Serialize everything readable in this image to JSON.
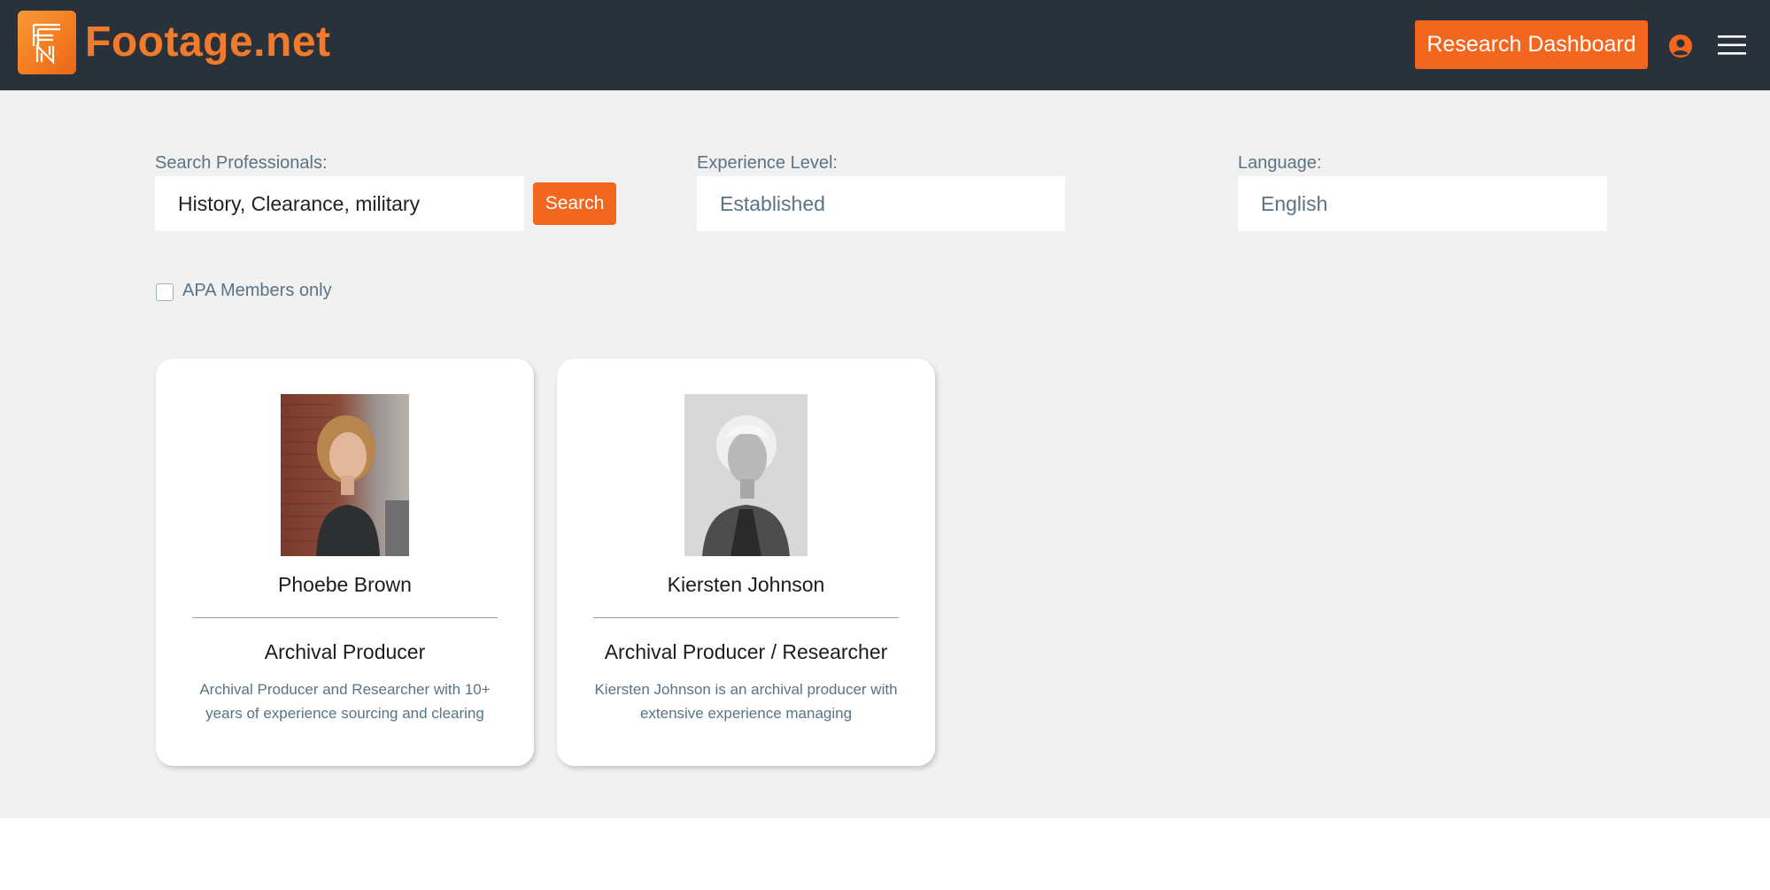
{
  "header": {
    "brand": "Footage.net",
    "dashboard_button": "Research Dashboard",
    "icons": [
      "user-icon",
      "hamburger-menu-icon"
    ],
    "accent_color": "#f2661e",
    "bar_color": "#29323b"
  },
  "filters": {
    "search_label": "Search Professionals:",
    "search_value": "History, Clearance, military",
    "search_button": "Search",
    "experience_label": "Experience Level:",
    "experience_value": "Established",
    "language_label": "Language:",
    "language_value": "English",
    "apa_checkbox_label": "APA Members only",
    "apa_checked": false
  },
  "results": [
    {
      "name": "Phoebe Brown",
      "role": "Archival Producer",
      "description": "Archival Producer and Researcher with 10+ years of experience sourcing and clearing"
    },
    {
      "name": "Kiersten Johnson",
      "role": "Archival Producer / Researcher",
      "description": "Kiersten Johnson is an archival producer with extensive experience managing"
    }
  ]
}
